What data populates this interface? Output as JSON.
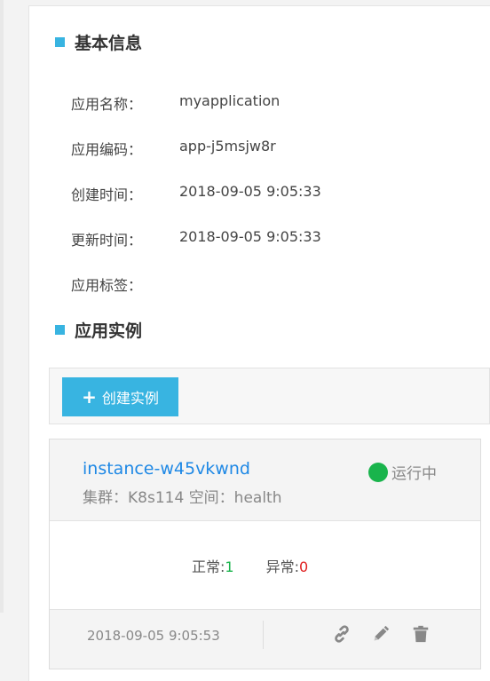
{
  "basic_info": {
    "title": "基本信息",
    "rows": [
      {
        "label": "应用名称：",
        "value": "myapplication"
      },
      {
        "label": "应用编码：",
        "value": "app-j5msjw8r"
      },
      {
        "label": "创建时间：",
        "value": "2018-09-05 9:05:33"
      },
      {
        "label": "更新时间：",
        "value": "2018-09-05 9:05:33"
      },
      {
        "label": "应用标签：",
        "value": ""
      }
    ]
  },
  "instances": {
    "title": "应用实例",
    "create_button_label": "创建实例",
    "create_button_icon": "plus-icon",
    "accent_color": "#38b4e1",
    "items": [
      {
        "name": "instance-w45vkwnd",
        "cluster_text": "集群：K8s114",
        "space_text": "空间：health",
        "status_label": "运行中",
        "status_color": "#19b44c",
        "normal_label": "正常:",
        "normal_count": "1",
        "abnormal_label": "异常:",
        "abnormal_count": "0",
        "timestamp": "2018-09-05 9:05:53",
        "actions": [
          "link-icon",
          "edit-icon",
          "delete-icon"
        ]
      }
    ]
  }
}
